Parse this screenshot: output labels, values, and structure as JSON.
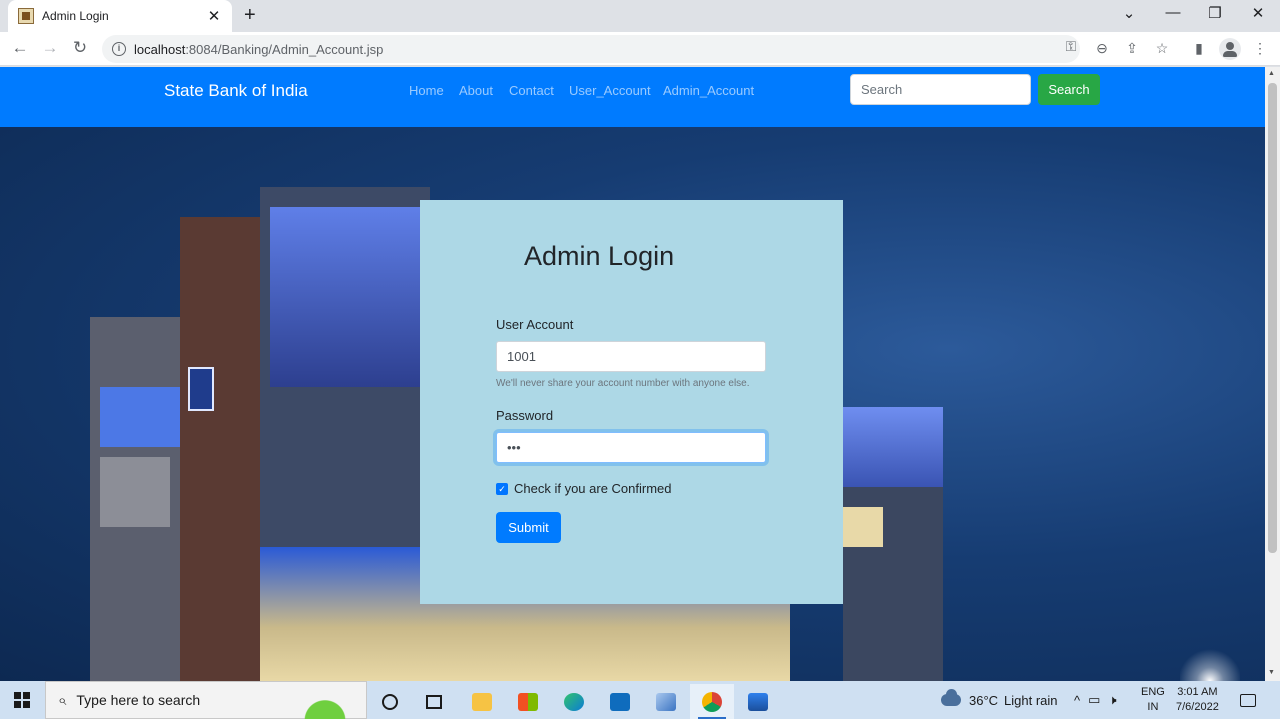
{
  "browser": {
    "tab_title": "Admin Login",
    "tab_close": "✕",
    "new_tab": "+",
    "url_host": "localhost",
    "url_rest": ":8084/Banking/Admin_Account.jsp",
    "controls": {
      "tab_list": "⌄",
      "minimize": "—",
      "restore": "❐",
      "close": "✕"
    }
  },
  "navbar": {
    "brand": "State Bank of India",
    "links": [
      "Home",
      "About",
      "Contact",
      "User_Account",
      "Admin_Account"
    ],
    "search_placeholder": "Search",
    "search_button": "Search",
    "color": "#007bff"
  },
  "login": {
    "title": "Admin Login",
    "account_label": "User Account",
    "account_value": "1001",
    "account_help": "We'll never share your account number with anyone else.",
    "password_label": "Password",
    "password_value": "•••",
    "confirm_label": "Check if you are Confirmed",
    "confirm_checked": true,
    "submit_label": "Submit",
    "card_color": "#add8e6"
  },
  "taskbar": {
    "search_placeholder": "Type here to search",
    "weather_temp": "36°C",
    "weather_desc": "Light rain",
    "lang_top": "ENG",
    "lang_bottom": "IN",
    "time": "3:01 AM",
    "date": "7/6/2022",
    "apps": [
      "cortana-icon",
      "task-view-icon",
      "file-explorer-icon",
      "store-icon",
      "edge-icon",
      "mail-icon",
      "3d-viewer-icon",
      "chrome-icon",
      "photos-icon"
    ]
  }
}
